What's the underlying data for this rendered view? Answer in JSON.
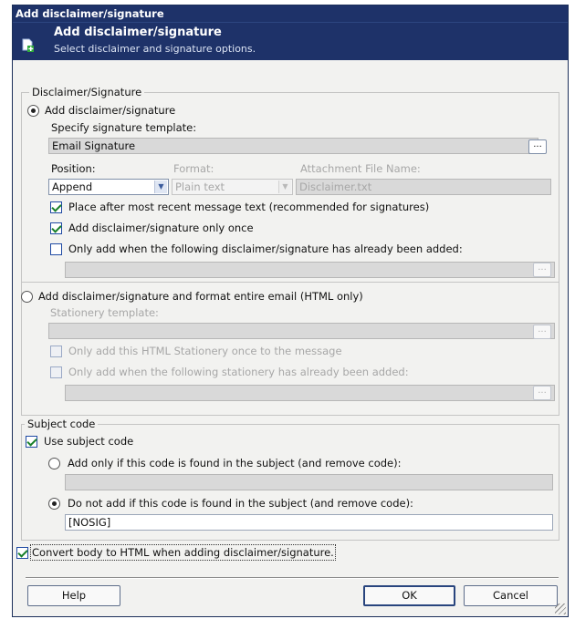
{
  "window": {
    "title": "Add disclaimer/signature",
    "header_title": "Add disclaimer/signature",
    "header_subtitle": "Select disclaimer and signature options."
  },
  "disclaimer_group": {
    "legend": "Disclaimer/Signature",
    "option_add": {
      "label": "Add disclaimer/signature",
      "selected": true,
      "template_label": "Specify signature template:",
      "template_value": "Email Signature",
      "browse_label": "...",
      "position_label": "Position:",
      "position_value": "Append",
      "format_label": "Format:",
      "format_value": "Plain text",
      "attachment_label": "Attachment File Name:",
      "attachment_value": "Disclaimer.txt",
      "place_after_label": "Place after most recent message text (recommended for signatures)",
      "place_after_checked": true,
      "once_label": "Add disclaimer/signature only once",
      "once_checked": true,
      "only_when_label": "Only add when the following disclaimer/signature has already been added:",
      "only_when_checked": false,
      "only_when_value": ""
    },
    "option_format": {
      "label": "Add disclaimer/signature and format entire email (HTML only)",
      "selected": false,
      "stationery_label": "Stationery template:",
      "stationery_value": "",
      "once_label": "Only add this HTML Stationery once to the message",
      "once_checked": false,
      "only_when_label": "Only add when the following stationery has already been added:",
      "only_when_checked": false,
      "only_when_value": ""
    }
  },
  "subject_group": {
    "legend": "Subject code",
    "use_label": "Use subject code",
    "use_checked": true,
    "found_label": "Add only if this code is found in the subject (and remove code):",
    "found_selected": false,
    "found_value": "",
    "not_found_label": "Do not add if this code is found in the subject (and remove code):",
    "not_found_selected": true,
    "not_found_value": "[NOSIG]"
  },
  "convert": {
    "label": "Convert body to HTML when adding disclaimer/signature.",
    "checked": true
  },
  "buttons": {
    "help": "Help",
    "ok": "OK",
    "cancel": "Cancel"
  },
  "icons": {
    "header": "document-add-icon",
    "dropdown": "chevron-down-icon",
    "resize": "resize-grip-icon"
  },
  "colors": {
    "titlebar": "#1e3269",
    "check": "#18802a",
    "disabled_text": "#a7a7a7"
  }
}
